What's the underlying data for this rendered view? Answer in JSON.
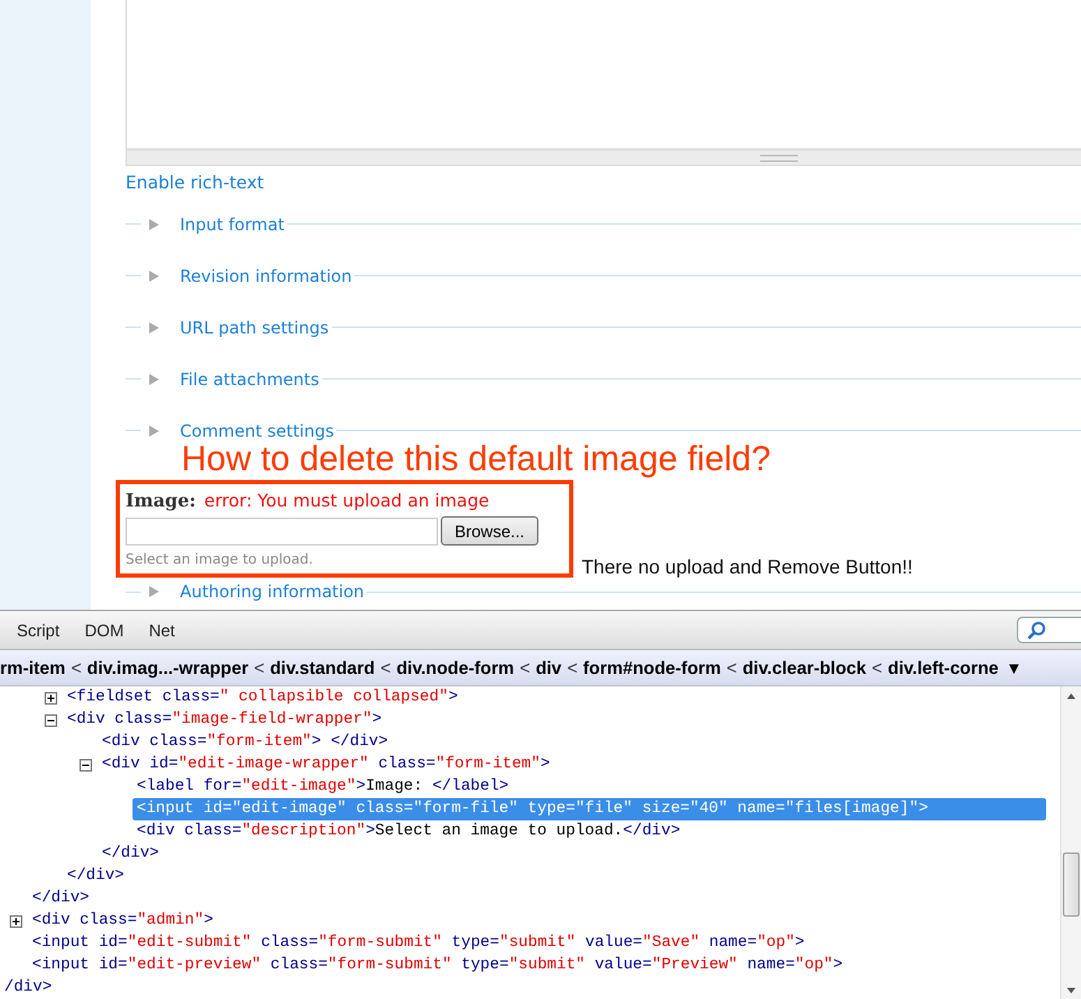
{
  "page": {
    "rich_text_link": "Enable rich-text",
    "fieldsets": [
      {
        "legend": "Input format",
        "expanded": false
      },
      {
        "legend": "Revision information",
        "expanded": false
      },
      {
        "legend": "URL path settings",
        "expanded": false
      },
      {
        "legend": "File attachments",
        "expanded": false
      },
      {
        "legend": "Comment settings",
        "expanded": false
      }
    ],
    "image_field": {
      "label": "Image:",
      "error": "error: You must upload an image",
      "button": "Browse...",
      "description": "Select an image to upload."
    },
    "fieldsets_after": [
      {
        "legend": "Authoring information",
        "expanded": false
      }
    ]
  },
  "annotations": {
    "question": "How to delete this default image field?",
    "note": "There no upload and Remove Button!!"
  },
  "firebug": {
    "tabs": [
      {
        "label": "Script",
        "selected": false
      },
      {
        "label": "DOM",
        "selected": false
      },
      {
        "label": "Net",
        "selected": false
      }
    ],
    "breadcrumb": [
      {
        "kind": "crumb",
        "text": "rm-item"
      },
      {
        "kind": "sep",
        "text": "<"
      },
      {
        "kind": "crumb",
        "text": "div.imag...-wrapper"
      },
      {
        "kind": "sep",
        "text": "<"
      },
      {
        "kind": "crumb",
        "text": "div.standard"
      },
      {
        "kind": "sep",
        "text": "<"
      },
      {
        "kind": "crumb",
        "text": "div.node-form"
      },
      {
        "kind": "sep",
        "text": "<"
      },
      {
        "kind": "crumb",
        "text": "div"
      },
      {
        "kind": "sep",
        "text": "<"
      },
      {
        "kind": "crumb",
        "text": "form#node-form"
      },
      {
        "kind": "sep",
        "text": "<"
      },
      {
        "kind": "crumb",
        "text": "div.clear-block"
      },
      {
        "kind": "sep",
        "text": "<"
      },
      {
        "kind": "crumb",
        "text": "div.left-corne"
      },
      {
        "kind": "more",
        "text": "▼"
      }
    ],
    "tree": [
      {
        "children": [
          {
            "children": [
              {
                "selected": false,
                "expanded": false,
                "parts": [
                  {
                    "kind": "tag",
                    "text": "<fieldset class="
                  },
                  {
                    "kind": "val",
                    "text": "\" collapsible collapsed\""
                  },
                  {
                    "kind": "tag",
                    "text": ">"
                  }
                ]
              },
              {
                "selected": false,
                "expanded": true,
                "parts": [
                  {
                    "kind": "tag",
                    "text": "<div class="
                  },
                  {
                    "kind": "val",
                    "text": "\"image-field-wrapper\""
                  },
                  {
                    "kind": "tag",
                    "text": ">"
                  }
                ],
                "children": [
                  {
                    "selected": false,
                    "parts": [
                      {
                        "kind": "tag",
                        "text": "<div class="
                      },
                      {
                        "kind": "val",
                        "text": "\"form-item\""
                      },
                      {
                        "kind": "tag",
                        "text": ">  </div>"
                      }
                    ]
                  },
                  {
                    "selected": false,
                    "expanded": true,
                    "parts": [
                      {
                        "kind": "tag",
                        "text": "<div id="
                      },
                      {
                        "kind": "val",
                        "text": "\"edit-image-wrapper\""
                      },
                      {
                        "kind": "tag",
                        "text": " class="
                      },
                      {
                        "kind": "val",
                        "text": "\"form-item\""
                      },
                      {
                        "kind": "tag",
                        "text": ">"
                      }
                    ],
                    "children": [
                      {
                        "selected": false,
                        "parts": [
                          {
                            "kind": "tag",
                            "text": "<label for="
                          },
                          {
                            "kind": "val",
                            "text": "\"edit-image\""
                          },
                          {
                            "kind": "tag",
                            "text": ">"
                          },
                          {
                            "kind": "txt",
                            "text": "Image: "
                          },
                          {
                            "kind": "tag",
                            "text": "</label>"
                          }
                        ]
                      },
                      {
                        "selected": true,
                        "parts": [
                          {
                            "kind": "tag",
                            "text": "<input id="
                          },
                          {
                            "kind": "val",
                            "text": "\"edit-image\""
                          },
                          {
                            "kind": "tag",
                            "text": " class="
                          },
                          {
                            "kind": "val",
                            "text": "\"form-file\""
                          },
                          {
                            "kind": "tag",
                            "text": " type="
                          },
                          {
                            "kind": "val",
                            "text": "\"file\""
                          },
                          {
                            "kind": "tag",
                            "text": " size="
                          },
                          {
                            "kind": "val",
                            "text": "\"40\""
                          },
                          {
                            "kind": "tag",
                            "text": " name="
                          },
                          {
                            "kind": "val",
                            "text": "\"files[image]\""
                          },
                          {
                            "kind": "tag",
                            "text": ">"
                          }
                        ]
                      },
                      {
                        "selected": false,
                        "parts": [
                          {
                            "kind": "tag",
                            "text": "<div class="
                          },
                          {
                            "kind": "val",
                            "text": "\"description\""
                          },
                          {
                            "kind": "tag",
                            "text": ">"
                          },
                          {
                            "kind": "txt",
                            "text": "Select an image to upload."
                          },
                          {
                            "kind": "tag",
                            "text": "</div>"
                          }
                        ]
                      }
                    ],
                    "close": [
                      {
                        "kind": "tag",
                        "text": "</div>"
                      }
                    ]
                  }
                ],
                "close": [
                  {
                    "kind": "tag",
                    "text": "</div>"
                  }
                ]
              }
            ],
            "close": [
              {
                "kind": "tag",
                "text": "</div>"
              }
            ]
          },
          {
            "selected": false,
            "expanded": false,
            "parts": [
              {
                "kind": "tag",
                "text": "<div class="
              },
              {
                "kind": "val",
                "text": "\"admin\""
              },
              {
                "kind": "tag",
                "text": ">"
              }
            ]
          },
          {
            "selected": false,
            "parts": [
              {
                "kind": "tag",
                "text": "<input id="
              },
              {
                "kind": "val",
                "text": "\"edit-submit\""
              },
              {
                "kind": "tag",
                "text": " class="
              },
              {
                "kind": "val",
                "text": "\"form-submit\""
              },
              {
                "kind": "tag",
                "text": " type="
              },
              {
                "kind": "val",
                "text": "\"submit\""
              },
              {
                "kind": "tag",
                "text": " value="
              },
              {
                "kind": "val",
                "text": "\"Save\""
              },
              {
                "kind": "tag",
                "text": " name="
              },
              {
                "kind": "val",
                "text": "\"op\""
              },
              {
                "kind": "tag",
                "text": ">"
              }
            ]
          },
          {
            "selected": false,
            "parts": [
              {
                "kind": "tag",
                "text": "<input id="
              },
              {
                "kind": "val",
                "text": "\"edit-preview\""
              },
              {
                "kind": "tag",
                "text": " class="
              },
              {
                "kind": "val",
                "text": "\"form-submit\""
              },
              {
                "kind": "tag",
                "text": " type="
              },
              {
                "kind": "val",
                "text": "\"submit\""
              },
              {
                "kind": "tag",
                "text": " value="
              },
              {
                "kind": "val",
                "text": "\"Preview\""
              },
              {
                "kind": "tag",
                "text": " name="
              },
              {
                "kind": "val",
                "text": "\"op\""
              },
              {
                "kind": "tag",
                "text": ">"
              }
            ]
          }
        ],
        "close": [
          {
            "kind": "tag",
            "text": "/div>"
          }
        ]
      }
    ]
  }
}
